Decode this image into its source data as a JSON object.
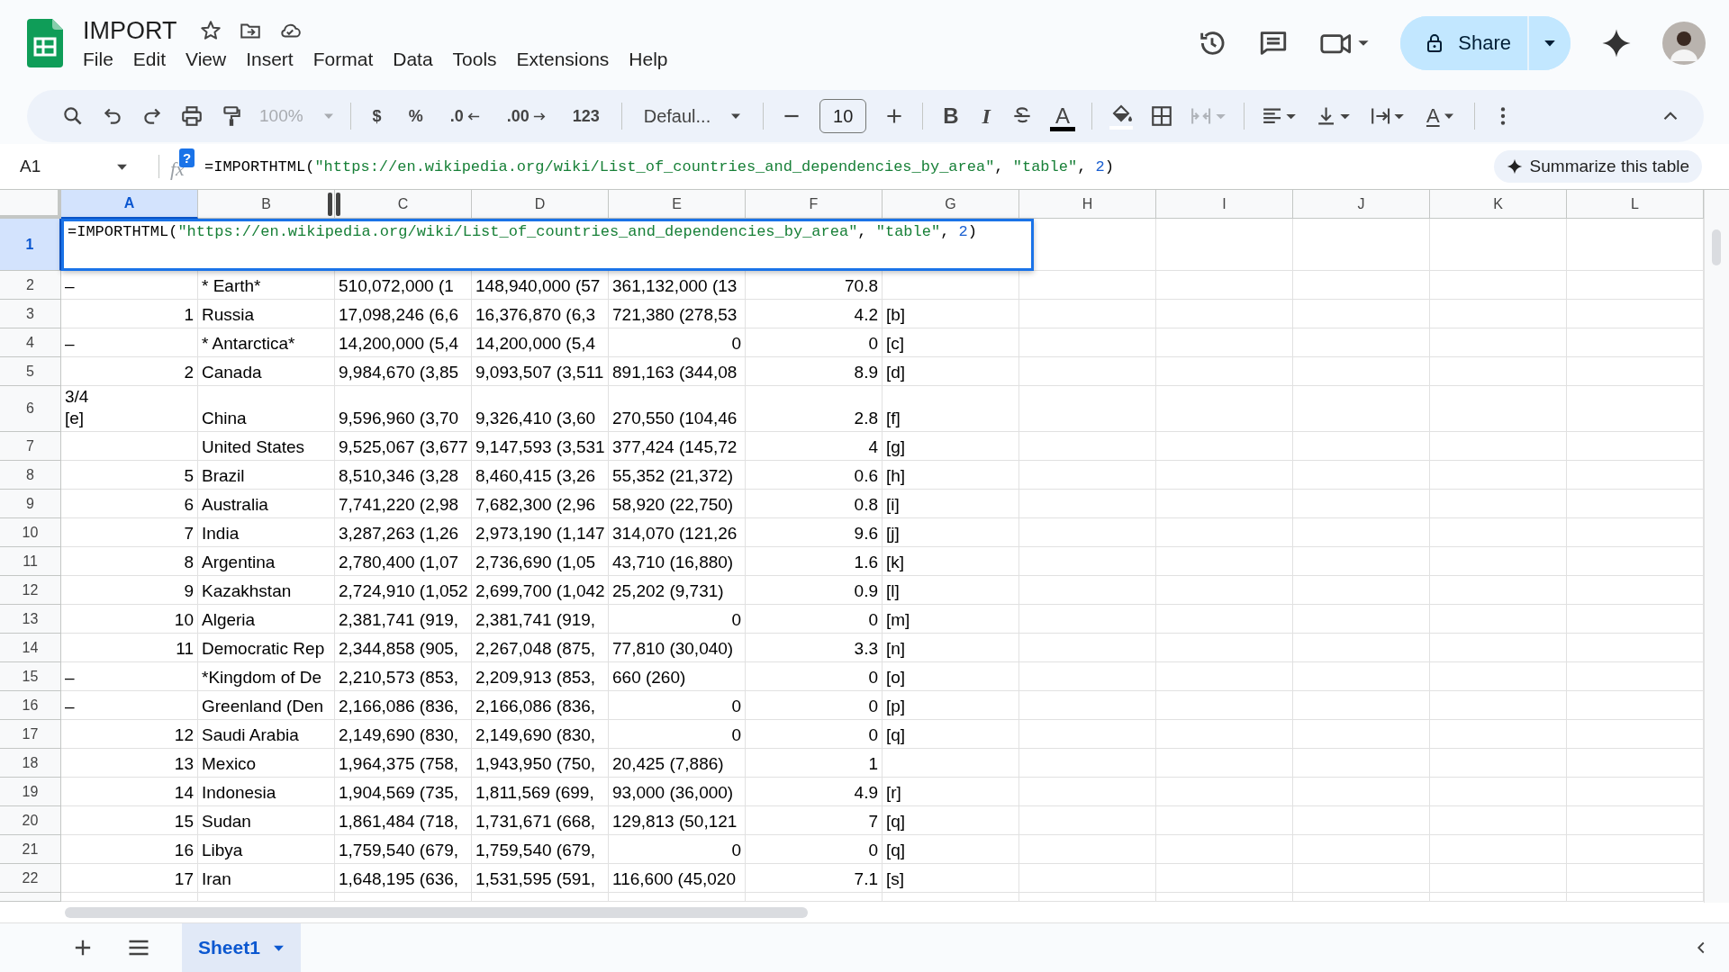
{
  "document": {
    "title": "IMPORT"
  },
  "menu": [
    "File",
    "Edit",
    "View",
    "Insert",
    "Format",
    "Data",
    "Tools",
    "Extensions",
    "Help"
  ],
  "share_button": {
    "label": "Share"
  },
  "toolbar": {
    "zoom": {
      "label": "100%",
      "disabled": true
    },
    "number_formats": [
      "$",
      "%",
      ".0",
      ".00",
      "123"
    ],
    "font": "Defaul...",
    "font_size": "10",
    "bold": "B",
    "italic": "I",
    "text_color": "A",
    "rotate": "A",
    "merge_disabled": true
  },
  "formula_bar": {
    "name_box": "A1",
    "fx_label": "fx",
    "help_badge": "?",
    "formula": [
      {
        "text": "=IMPORTHTML(",
        "kind": "plain"
      },
      {
        "text": "\"https://en.wikipedia.org/wiki/List_of_countries_and_dependencies_by_area\"",
        "kind": "string"
      },
      {
        "text": ", ",
        "kind": "plain"
      },
      {
        "text": "\"table\"",
        "kind": "string"
      },
      {
        "text": ", ",
        "kind": "plain"
      },
      {
        "text": "2",
        "kind": "number"
      },
      {
        "text": ")",
        "kind": "plain"
      }
    ],
    "summarize_chip": "Summarize this table"
  },
  "columns": [
    {
      "label": "A",
      "selected": true
    },
    {
      "label": "B",
      "selected": false
    },
    {
      "label": "C",
      "selected": false
    },
    {
      "label": "D",
      "selected": false
    },
    {
      "label": "E",
      "selected": false
    },
    {
      "label": "F",
      "selected": false
    },
    {
      "label": "G",
      "selected": false
    },
    {
      "label": "H",
      "selected": false
    },
    {
      "label": "I",
      "selected": false
    },
    {
      "label": "J",
      "selected": false
    },
    {
      "label": "K",
      "selected": false
    },
    {
      "label": "L",
      "selected": false
    }
  ],
  "rows": [
    {
      "label": "1",
      "selected": true,
      "kind": "editor",
      "formula": [
        {
          "text": "=IMPORTHTML(",
          "kind": "plain"
        },
        {
          "text": "\"https://en.wikipedia.org/wiki/List_of_countries_and_dependencies_by_area\"",
          "kind": "string"
        },
        {
          "text": ", ",
          "kind": "plain"
        },
        {
          "text": "\"table\"",
          "kind": "string"
        },
        {
          "text": ", ",
          "kind": "plain"
        },
        {
          "text": "2",
          "kind": "number"
        },
        {
          "text": ")",
          "kind": "plain"
        }
      ]
    },
    {
      "label": "2",
      "selected": false,
      "kind": "data",
      "cells": [
        {
          "text": "–",
          "kind": "text"
        },
        {
          "text": "* Earth*",
          "kind": "text"
        },
        {
          "text": "510,072,000 (1",
          "kind": "text"
        },
        {
          "text": "148,940,000 (57",
          "kind": "text"
        },
        {
          "text": "361,132,000 (13",
          "kind": "text"
        },
        {
          "text": "70.8",
          "kind": "number"
        },
        null
      ]
    },
    {
      "label": "3",
      "selected": false,
      "kind": "data",
      "cells": [
        {
          "text": "1",
          "kind": "number"
        },
        {
          "text": "Russia",
          "kind": "text"
        },
        {
          "text": "17,098,246 (6,6",
          "kind": "text"
        },
        {
          "text": "16,376,870 (6,3",
          "kind": "text"
        },
        {
          "text": "721,380 (278,53",
          "kind": "text"
        },
        {
          "text": "4.2",
          "kind": "number"
        },
        {
          "text": "[b]",
          "kind": "text"
        }
      ]
    },
    {
      "label": "4",
      "selected": false,
      "kind": "data",
      "cells": [
        {
          "text": "–",
          "kind": "text"
        },
        {
          "text": "* Antarctica*",
          "kind": "text"
        },
        {
          "text": "14,200,000 (5,4",
          "kind": "text"
        },
        {
          "text": "14,200,000 (5,4",
          "kind": "text"
        },
        {
          "text": "0",
          "kind": "number"
        },
        {
          "text": "0",
          "kind": "number"
        },
        {
          "text": "[c]",
          "kind": "text"
        }
      ]
    },
    {
      "label": "5",
      "selected": false,
      "kind": "data",
      "cells": [
        {
          "text": "2",
          "kind": "number"
        },
        {
          "text": "Canada",
          "kind": "text"
        },
        {
          "text": "9,984,670 (3,85",
          "kind": "text"
        },
        {
          "text": "9,093,507 (3,511",
          "kind": "text"
        },
        {
          "text": "891,163 (344,08",
          "kind": "text"
        },
        {
          "text": "8.9",
          "kind": "number"
        },
        {
          "text": "[d]",
          "kind": "text"
        }
      ]
    },
    {
      "label": "6",
      "selected": false,
      "kind": "data",
      "cells": [
        {
          "text": "3/4\n[e]",
          "kind": "text"
        },
        {
          "text": "China",
          "kind": "text"
        },
        {
          "text": "9,596,960 (3,70",
          "kind": "text"
        },
        {
          "text": "9,326,410 (3,60",
          "kind": "text"
        },
        {
          "text": "270,550 (104,46",
          "kind": "text"
        },
        {
          "text": "2.8",
          "kind": "number"
        },
        {
          "text": "[f]",
          "kind": "text"
        }
      ]
    },
    {
      "label": "7",
      "selected": false,
      "kind": "data",
      "cells": [
        null,
        {
          "text": "United States",
          "kind": "text"
        },
        {
          "text": "9,525,067 (3,677",
          "kind": "text"
        },
        {
          "text": "9,147,593 (3,531",
          "kind": "text"
        },
        {
          "text": "377,424 (145,72",
          "kind": "text"
        },
        {
          "text": "4",
          "kind": "number"
        },
        {
          "text": "[g]",
          "kind": "text"
        }
      ]
    },
    {
      "label": "8",
      "selected": false,
      "kind": "data",
      "cells": [
        {
          "text": "5",
          "kind": "number"
        },
        {
          "text": "Brazil",
          "kind": "text"
        },
        {
          "text": "8,510,346 (3,28",
          "kind": "text"
        },
        {
          "text": "8,460,415 (3,26",
          "kind": "text"
        },
        {
          "text": "55,352 (21,372)",
          "kind": "text"
        },
        {
          "text": "0.6",
          "kind": "number"
        },
        {
          "text": "[h]",
          "kind": "text"
        }
      ]
    },
    {
      "label": "9",
      "selected": false,
      "kind": "data",
      "cells": [
        {
          "text": "6",
          "kind": "number"
        },
        {
          "text": "Australia",
          "kind": "text"
        },
        {
          "text": "7,741,220 (2,98",
          "kind": "text"
        },
        {
          "text": "7,682,300 (2,96",
          "kind": "text"
        },
        {
          "text": "58,920 (22,750)",
          "kind": "text"
        },
        {
          "text": "0.8",
          "kind": "number"
        },
        {
          "text": "[i]",
          "kind": "text"
        }
      ]
    },
    {
      "label": "10",
      "selected": false,
      "kind": "data",
      "cells": [
        {
          "text": "7",
          "kind": "number"
        },
        {
          "text": "India",
          "kind": "text"
        },
        {
          "text": "3,287,263 (1,26",
          "kind": "text"
        },
        {
          "text": "2,973,190 (1,147",
          "kind": "text"
        },
        {
          "text": "314,070 (121,26",
          "kind": "text"
        },
        {
          "text": "9.6",
          "kind": "number"
        },
        {
          "text": "[j]",
          "kind": "text"
        }
      ]
    },
    {
      "label": "11",
      "selected": false,
      "kind": "data",
      "cells": [
        {
          "text": "8",
          "kind": "number"
        },
        {
          "text": "Argentina",
          "kind": "text"
        },
        {
          "text": "2,780,400 (1,07",
          "kind": "text"
        },
        {
          "text": "2,736,690 (1,05",
          "kind": "text"
        },
        {
          "text": "43,710 (16,880)",
          "kind": "text"
        },
        {
          "text": "1.6",
          "kind": "number"
        },
        {
          "text": "[k]",
          "kind": "text"
        }
      ]
    },
    {
      "label": "12",
      "selected": false,
      "kind": "data",
      "cells": [
        {
          "text": "9",
          "kind": "number"
        },
        {
          "text": "Kazakhstan",
          "kind": "text"
        },
        {
          "text": "2,724,910 (1,052",
          "kind": "text"
        },
        {
          "text": "2,699,700 (1,042",
          "kind": "text"
        },
        {
          "text": "25,202 (9,731)",
          "kind": "text"
        },
        {
          "text": "0.9",
          "kind": "number"
        },
        {
          "text": "[l]",
          "kind": "text"
        }
      ]
    },
    {
      "label": "13",
      "selected": false,
      "kind": "data",
      "cells": [
        {
          "text": "10",
          "kind": "number"
        },
        {
          "text": "Algeria",
          "kind": "text"
        },
        {
          "text": "2,381,741 (919,",
          "kind": "text"
        },
        {
          "text": "2,381,741 (919,",
          "kind": "text"
        },
        {
          "text": "0",
          "kind": "number"
        },
        {
          "text": "0",
          "kind": "number"
        },
        {
          "text": "[m]",
          "kind": "text"
        }
      ]
    },
    {
      "label": "14",
      "selected": false,
      "kind": "data",
      "cells": [
        {
          "text": "11",
          "kind": "number"
        },
        {
          "text": "Democratic Rep",
          "kind": "text"
        },
        {
          "text": "2,344,858 (905,",
          "kind": "text"
        },
        {
          "text": "2,267,048 (875,",
          "kind": "text"
        },
        {
          "text": "77,810 (30,040)",
          "kind": "text"
        },
        {
          "text": "3.3",
          "kind": "number"
        },
        {
          "text": "[n]",
          "kind": "text"
        }
      ]
    },
    {
      "label": "15",
      "selected": false,
      "kind": "data",
      "cells": [
        {
          "text": "–",
          "kind": "text"
        },
        {
          "text": "*Kingdom of De",
          "kind": "text"
        },
        {
          "text": "2,210,573 (853,",
          "kind": "text"
        },
        {
          "text": "2,209,913 (853,",
          "kind": "text"
        },
        {
          "text": "660 (260)",
          "kind": "text"
        },
        {
          "text": "0",
          "kind": "number"
        },
        {
          "text": "[o]",
          "kind": "text"
        }
      ]
    },
    {
      "label": "16",
      "selected": false,
      "kind": "data",
      "cells": [
        {
          "text": "–",
          "kind": "text"
        },
        {
          "text": "Greenland (Den",
          "kind": "text"
        },
        {
          "text": "2,166,086 (836,",
          "kind": "text"
        },
        {
          "text": "2,166,086 (836,",
          "kind": "text"
        },
        {
          "text": "0",
          "kind": "number"
        },
        {
          "text": "0",
          "kind": "number"
        },
        {
          "text": "[p]",
          "kind": "text"
        }
      ]
    },
    {
      "label": "17",
      "selected": false,
      "kind": "data",
      "cells": [
        {
          "text": "12",
          "kind": "number"
        },
        {
          "text": "Saudi Arabia",
          "kind": "text"
        },
        {
          "text": "2,149,690 (830,",
          "kind": "text"
        },
        {
          "text": "2,149,690 (830,",
          "kind": "text"
        },
        {
          "text": "0",
          "kind": "number"
        },
        {
          "text": "0",
          "kind": "number"
        },
        {
          "text": "[q]",
          "kind": "text"
        }
      ]
    },
    {
      "label": "18",
      "selected": false,
      "kind": "data",
      "cells": [
        {
          "text": "13",
          "kind": "number"
        },
        {
          "text": "Mexico",
          "kind": "text"
        },
        {
          "text": "1,964,375 (758,",
          "kind": "text"
        },
        {
          "text": "1,943,950 (750,",
          "kind": "text"
        },
        {
          "text": "20,425 (7,886)",
          "kind": "text"
        },
        {
          "text": "1",
          "kind": "number"
        },
        null
      ]
    },
    {
      "label": "19",
      "selected": false,
      "kind": "data",
      "cells": [
        {
          "text": "14",
          "kind": "number"
        },
        {
          "text": "Indonesia",
          "kind": "text"
        },
        {
          "text": "1,904,569 (735,",
          "kind": "text"
        },
        {
          "text": "1,811,569 (699,",
          "kind": "text"
        },
        {
          "text": "93,000 (36,000)",
          "kind": "text"
        },
        {
          "text": "4.9",
          "kind": "number"
        },
        {
          "text": "[r]",
          "kind": "text"
        }
      ]
    },
    {
      "label": "20",
      "selected": false,
      "kind": "data",
      "cells": [
        {
          "text": "15",
          "kind": "number"
        },
        {
          "text": "Sudan",
          "kind": "text"
        },
        {
          "text": "1,861,484 (718,",
          "kind": "text"
        },
        {
          "text": "1,731,671 (668,",
          "kind": "text"
        },
        {
          "text": "129,813 (50,121",
          "kind": "text"
        },
        {
          "text": "7",
          "kind": "number"
        },
        {
          "text": "[q]",
          "kind": "text"
        }
      ]
    },
    {
      "label": "21",
      "selected": false,
      "kind": "data",
      "cells": [
        {
          "text": "16",
          "kind": "number"
        },
        {
          "text": "Libya",
          "kind": "text"
        },
        {
          "text": "1,759,540 (679,",
          "kind": "text"
        },
        {
          "text": "1,759,540 (679,",
          "kind": "text"
        },
        {
          "text": "0",
          "kind": "number"
        },
        {
          "text": "0",
          "kind": "number"
        },
        {
          "text": "[q]",
          "kind": "text"
        }
      ]
    },
    {
      "label": "22",
      "selected": false,
      "kind": "data",
      "cells": [
        {
          "text": "17",
          "kind": "number"
        },
        {
          "text": "Iran",
          "kind": "text"
        },
        {
          "text": "1,648,195 (636,",
          "kind": "text"
        },
        {
          "text": "1,531,595 (591,",
          "kind": "text"
        },
        {
          "text": "116,600 (45,020",
          "kind": "text"
        },
        {
          "text": "7.1",
          "kind": "number"
        },
        {
          "text": "[s]",
          "kind": "text"
        }
      ]
    }
  ],
  "sheet_tabs": [
    {
      "label": "Sheet1",
      "selected": true
    }
  ]
}
